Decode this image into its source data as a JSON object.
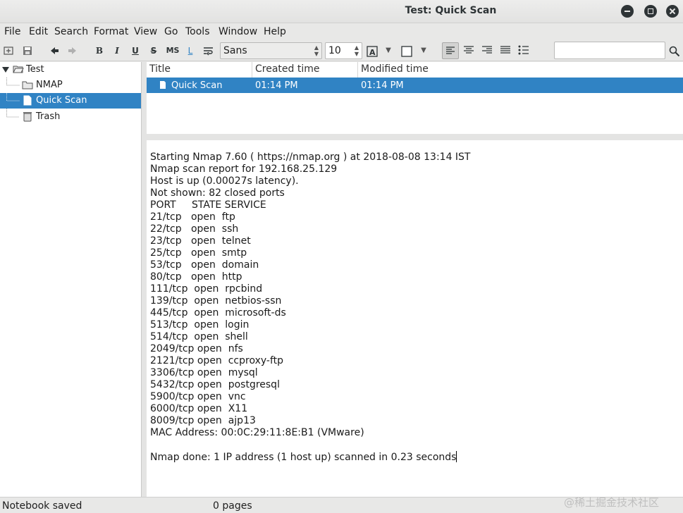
{
  "window": {
    "title": "Test: Quick Scan"
  },
  "menu": [
    "File",
    "Edit",
    "Search",
    "Format",
    "View",
    "Go",
    "Tools",
    "Window",
    "Help"
  ],
  "toolbar": {
    "font_name": "Sans",
    "font_size": "10",
    "search_value": ""
  },
  "tree": {
    "root": "Test",
    "items": [
      {
        "label": "NMAP",
        "icon": "folder-icon"
      },
      {
        "label": "Quick Scan",
        "icon": "page-icon"
      },
      {
        "label": "Trash",
        "icon": "trash-icon"
      }
    ]
  },
  "list": {
    "columns": [
      "Title",
      "Created time",
      "Modified time"
    ],
    "rows": [
      {
        "title": "Quick Scan",
        "created": "01:14 PM",
        "modified": "01:14 PM"
      }
    ]
  },
  "editor": {
    "lines": [
      "Starting Nmap 7.60 ( https://nmap.org ) at 2018-08-08 13:14 IST",
      "Nmap scan report for 192.168.25.129",
      "Host is up (0.00027s latency).",
      "Not shown: 82 closed ports",
      "PORT     STATE SERVICE",
      "21/tcp   open  ftp",
      "22/tcp   open  ssh",
      "23/tcp   open  telnet",
      "25/tcp   open  smtp",
      "53/tcp   open  domain",
      "80/tcp   open  http",
      "111/tcp  open  rpcbind",
      "139/tcp  open  netbios-ssn",
      "445/tcp  open  microsoft-ds",
      "513/tcp  open  login",
      "514/tcp  open  shell",
      "2049/tcp open  nfs",
      "2121/tcp open  ccproxy-ftp",
      "3306/tcp open  mysql",
      "5432/tcp open  postgresql",
      "5900/tcp open  vnc",
      "6000/tcp open  X11",
      "8009/tcp open  ajp13",
      "MAC Address: 00:0C:29:11:8E:B1 (VMware)",
      "",
      "Nmap done: 1 IP address (1 host up) scanned in 0.23 seconds"
    ]
  },
  "status": {
    "left": "Notebook saved",
    "pages": "0 pages",
    "watermark": "@稀土掘金技术社区"
  },
  "colors": {
    "selection": "#3083c4"
  }
}
